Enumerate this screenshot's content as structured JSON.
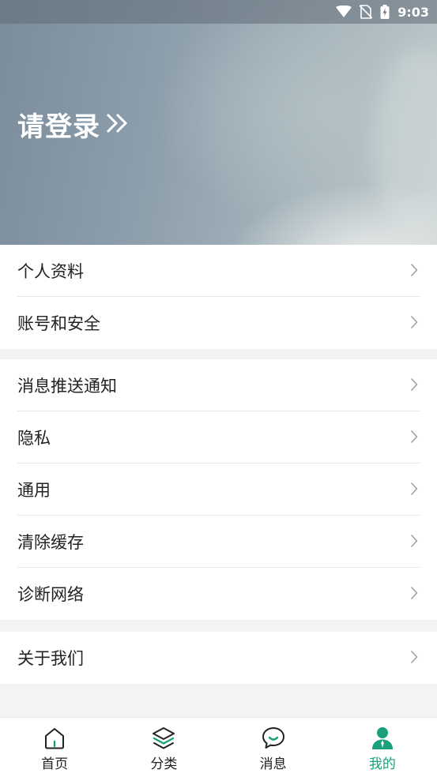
{
  "status_bar": {
    "time": "9:03"
  },
  "header": {
    "login_label": "请登录"
  },
  "groups": [
    {
      "items": [
        {
          "label": "个人资料"
        },
        {
          "label": "账号和安全"
        }
      ]
    },
    {
      "items": [
        {
          "label": "消息推送通知"
        },
        {
          "label": "隐私"
        },
        {
          "label": "通用"
        },
        {
          "label": "清除缓存"
        },
        {
          "label": "诊断网络"
        }
      ]
    },
    {
      "items": [
        {
          "label": "关于我们"
        }
      ]
    }
  ],
  "bottom_nav": {
    "tabs": [
      {
        "label": "首页",
        "icon": "home-icon"
      },
      {
        "label": "分类",
        "icon": "layers-icon"
      },
      {
        "label": "消息",
        "icon": "chat-bubble-icon"
      },
      {
        "label": "我的",
        "icon": "person-icon",
        "active": true
      }
    ]
  },
  "colors": {
    "accent": "#1aa07a",
    "text": "#222222",
    "separator": "#f3f3f3"
  }
}
